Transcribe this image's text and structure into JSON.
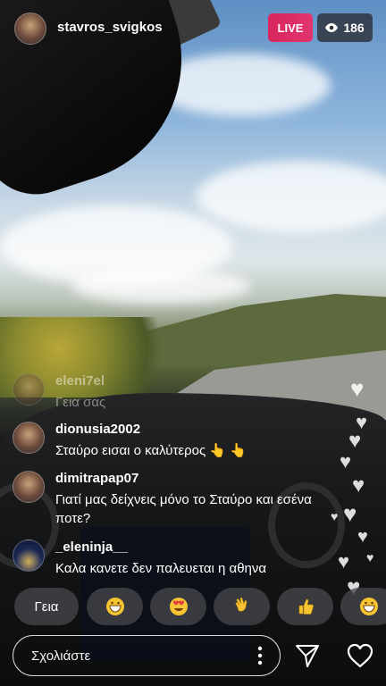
{
  "header": {
    "username": "stavros_svigkos",
    "live_label": "LIVE",
    "viewer_count": "186"
  },
  "comments": [
    {
      "user": "eleni7el",
      "text": "Γεια σας"
    },
    {
      "user": "dionusia2002",
      "text": "Σταύρο εισαι ο καλύτερος 👆 👆"
    },
    {
      "user": "dimitrapap07",
      "text": "Γιατί μας δείχνεις μόνο τo Σταύρο και εσένα ποτε?"
    },
    {
      "user": "_eleninja__",
      "text": "Καλα κανετε δεν παλευεται η αθηνα"
    }
  ],
  "quick_replies": {
    "text_reply": "Γεια",
    "emoji_replies": [
      "grinning-emoji",
      "heart-eyes-emoji",
      "waving-hand-emoji",
      "thumbs-up-emoji",
      "grinning-emoji"
    ]
  },
  "comment_bar": {
    "placeholder": "Σχολιάστε"
  },
  "colors": {
    "live_badge": "#e2346d",
    "emoji_yellow": "#f7c531"
  }
}
